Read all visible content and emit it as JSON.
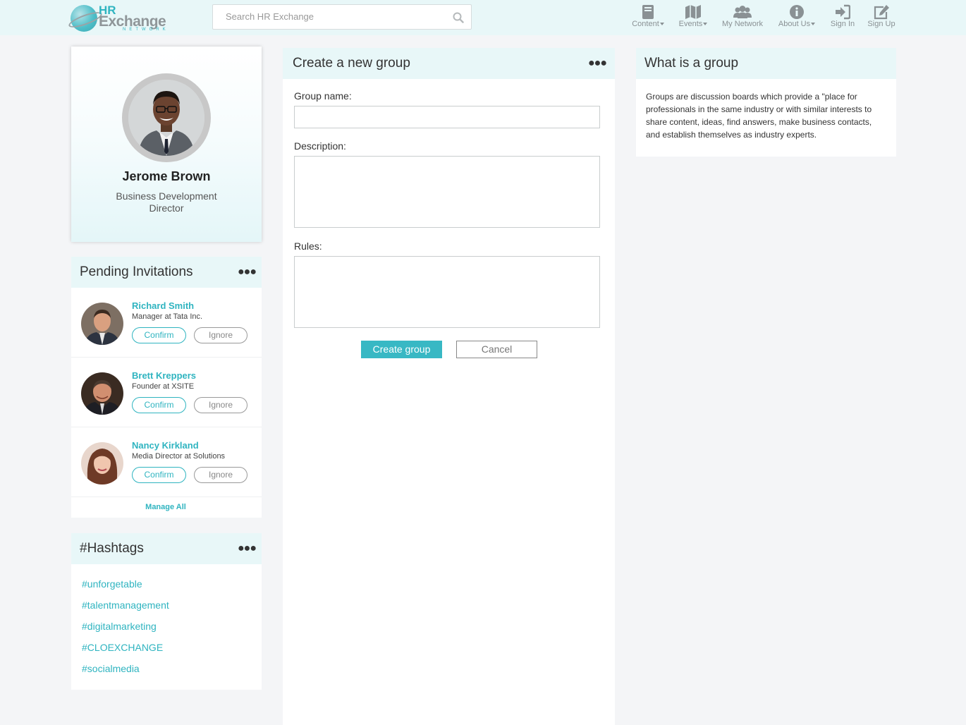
{
  "header": {
    "logo": {
      "hr": "HR",
      "exchange": "Exchange",
      "network": "NETWORK"
    },
    "search_placeholder": "Search HR Exchange",
    "nav": [
      {
        "label": "Content",
        "icon": "book-icon",
        "dropdown": true
      },
      {
        "label": "Events",
        "icon": "map-icon",
        "dropdown": true
      },
      {
        "label": "My Network",
        "icon": "users-icon",
        "dropdown": false
      },
      {
        "label": "About Us",
        "icon": "info-icon",
        "dropdown": true
      },
      {
        "label": "Sign In",
        "icon": "sign-in-icon",
        "dropdown": false
      },
      {
        "label": "Sign Up",
        "icon": "edit-icon",
        "dropdown": false
      }
    ]
  },
  "profile": {
    "name": "Jerome Brown",
    "title": "Business Development Director"
  },
  "invitations": {
    "title": "Pending Invitations",
    "items": [
      {
        "name": "Richard Smith",
        "role": "Manager at Tata Inc.",
        "confirm": "Confirm",
        "ignore": "Ignore"
      },
      {
        "name": "Brett Kreppers",
        "role": "Founder at XSITE",
        "confirm": "Confirm",
        "ignore": "Ignore"
      },
      {
        "name": "Nancy Kirkland",
        "role": "Media Director at Solutions",
        "confirm": "Confirm",
        "ignore": "Ignore"
      }
    ],
    "manage_all": "Manage All"
  },
  "hashtags": {
    "title": "#Hashtags",
    "items": [
      "unforgetable",
      "talentmanagement",
      "digitalmarketing",
      "CLOEXCHANGE",
      "socialmedia"
    ]
  },
  "create_group": {
    "title": "Create a new group",
    "group_name_label": "Group name:",
    "group_name_value": "",
    "description_label": "Description:",
    "description_value": "",
    "rules_label": "Rules:",
    "rules_value": "",
    "create_button": "Create group",
    "cancel_button": "Cancel"
  },
  "what_is_group": {
    "title": "What is a group",
    "text": "Groups are discussion boards which provide a \"place for professionals in the same industry or with similar interests to share content, ideas, find answers, make business contacts, and establish themselves as industry experts."
  },
  "colors": {
    "accent": "#2fb4c0",
    "header_bg": "#e8f7f8",
    "page_bg": "#f4f5f7"
  }
}
